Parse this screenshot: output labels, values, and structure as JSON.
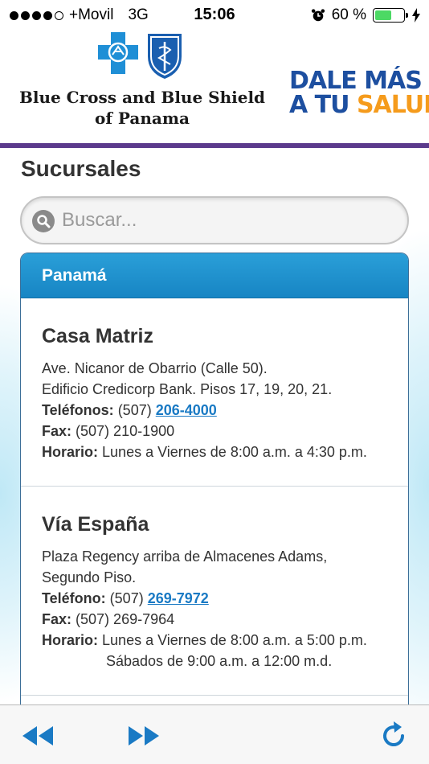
{
  "status": {
    "carrier": "+Movil",
    "network": "3G",
    "time": "15:06",
    "battery": "60 %",
    "battery_level": 0.6
  },
  "header": {
    "logo_line1": "Blue Cross and Blue Shield",
    "logo_line2": "of Panama",
    "slogan_line1": "DALE MÁS",
    "slogan_line2a": "A TU ",
    "slogan_line2b": "SALUD"
  },
  "page": {
    "title": "Sucursales"
  },
  "search": {
    "placeholder": "Buscar..."
  },
  "list": {
    "region": "Panamá",
    "branches": [
      {
        "name": "Casa Matriz",
        "address1": "Ave. Nicanor de Obarrio (Calle 50).",
        "address2": "Edificio Credicorp Bank. Pisos 17, 19, 20, 21.",
        "phone_label": "Teléfonos:",
        "phone_prefix": "(507)",
        "phone_link": "206-4000",
        "fax_label": "Fax:",
        "fax": "(507) 210-1900",
        "hours_label": "Horario:",
        "hours": "Lunes a Viernes de 8:00 a.m. a 4:30 p.m."
      },
      {
        "name": "Vía España",
        "address1": "Plaza Regency arriba de Almacenes Adams,",
        "address2": "Segundo Piso.",
        "phone_label": "Teléfono:",
        "phone_prefix": "(507)",
        "phone_link": "269-7972",
        "fax_label": "Fax:",
        "fax": "(507) 269-7964",
        "hours_label": "Horario:",
        "hours": "Lunes a Viernes de 8:00 a.m. a 5:00 p.m.",
        "hours2": "Sábados de 9:00 a.m. a 12:00 m.d."
      }
    ]
  },
  "colors": {
    "accent": "#1785c4",
    "brand_purple": "#5b3a8c",
    "link": "#1a7ac4"
  },
  "toolbar": {
    "back_icon": "rewind-icon",
    "forward_icon": "fast-forward-icon",
    "reload_icon": "reload-icon"
  }
}
